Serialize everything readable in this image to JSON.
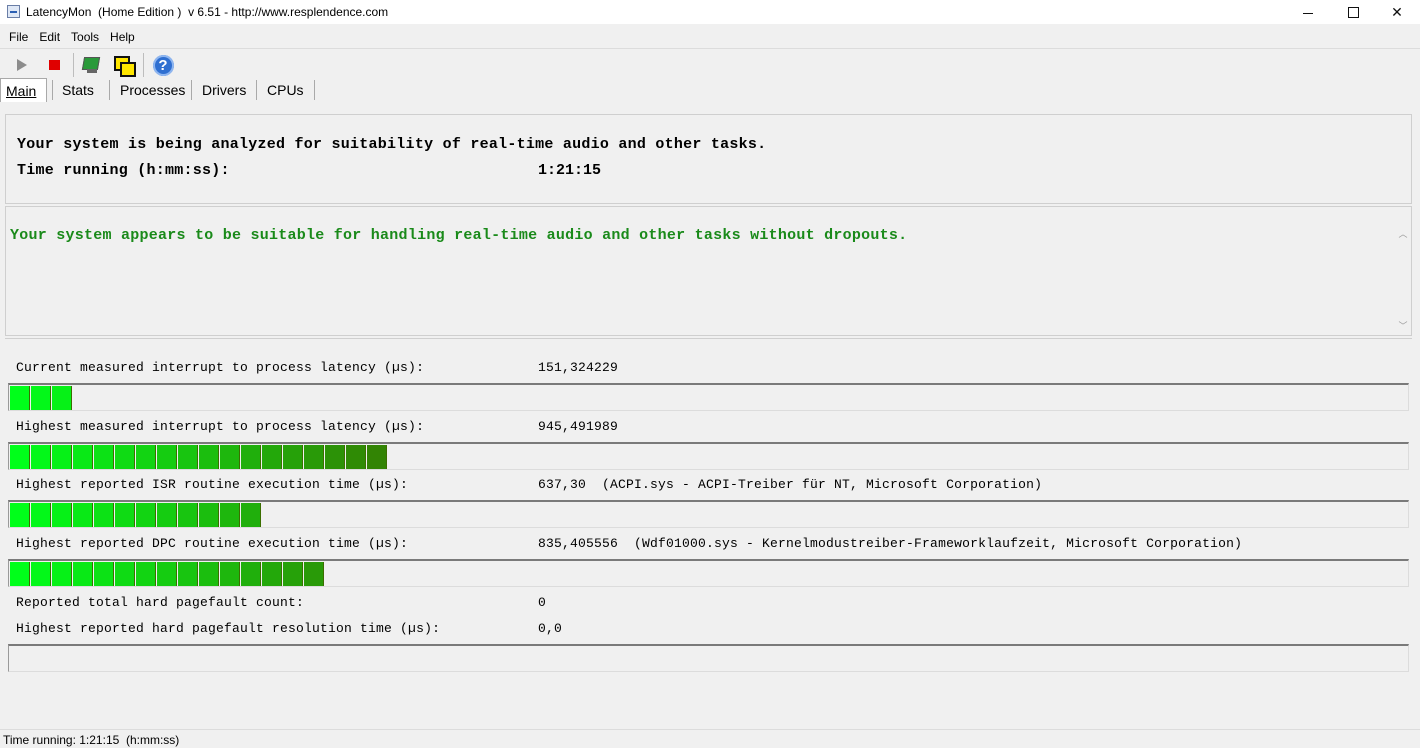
{
  "window": {
    "title": "LatencyMon  (Home Edition )  v 6.51 - http://www.resplendence.com"
  },
  "menu": {
    "items": [
      "File",
      "Edit",
      "Tools",
      "Help"
    ]
  },
  "toolbar": {
    "buttons": [
      "play-icon",
      "stop-icon",
      "monitor-icon",
      "windows-icon",
      "help-icon"
    ],
    "help_glyph": "?"
  },
  "tabs": [
    "Main",
    "Stats",
    "Processes",
    "Drivers",
    "CPUs"
  ],
  "analysis": {
    "line1": "Your system is being analyzed for suitability of real-time audio and other tasks.",
    "time_label": "Time running (h:mm:ss):",
    "time_value": "1:21:15"
  },
  "verdict": {
    "message": "Your system appears to be suitable for handling real-time audio and other tasks without dropouts.",
    "color": "#1a8a1a"
  },
  "metrics": [
    {
      "label": "Current measured interrupt to process latency (µs):",
      "value": "151,324229",
      "bar_segments": 3
    },
    {
      "label": "Highest measured interrupt to process latency (µs):",
      "value": "945,491989",
      "bar_segments": 18
    },
    {
      "label": "Highest reported ISR routine execution time (µs):",
      "value": "637,30  (ACPI.sys - ACPI-Treiber für NT, Microsoft Corporation)",
      "bar_segments": 12
    },
    {
      "label": "Highest reported DPC routine execution time (µs):",
      "value": "835,405556  (Wdf01000.sys - Kernelmodustreiber-Frameworklaufzeit, Microsoft Corporation)",
      "bar_segments": 15
    }
  ],
  "pagefault": {
    "count_label": "Reported total hard pagefault count:",
    "count_value": "0",
    "time_label": "Highest reported hard pagefault resolution time (µs):",
    "time_value": "0,0",
    "bar_segments": 0
  },
  "status": {
    "text": "Time running: 1:21:15  (h:mm:ss)"
  },
  "colors": {
    "bar_start": "#00ff1a",
    "bar_end": "#3b6e00"
  }
}
